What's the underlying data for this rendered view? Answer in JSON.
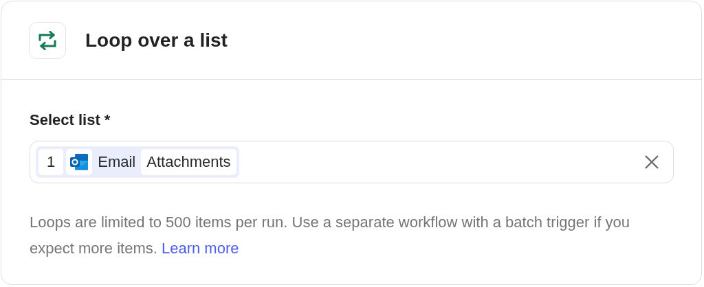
{
  "header": {
    "title": "Loop over a list"
  },
  "field": {
    "label": "Select list *",
    "token": {
      "step": "1",
      "app": "Email",
      "value": "Attachments"
    }
  },
  "help": {
    "text": "Loops are limited to 500 items per run. Use a separate workflow with a batch trigger if you expect more items.",
    "link": "Learn more"
  }
}
